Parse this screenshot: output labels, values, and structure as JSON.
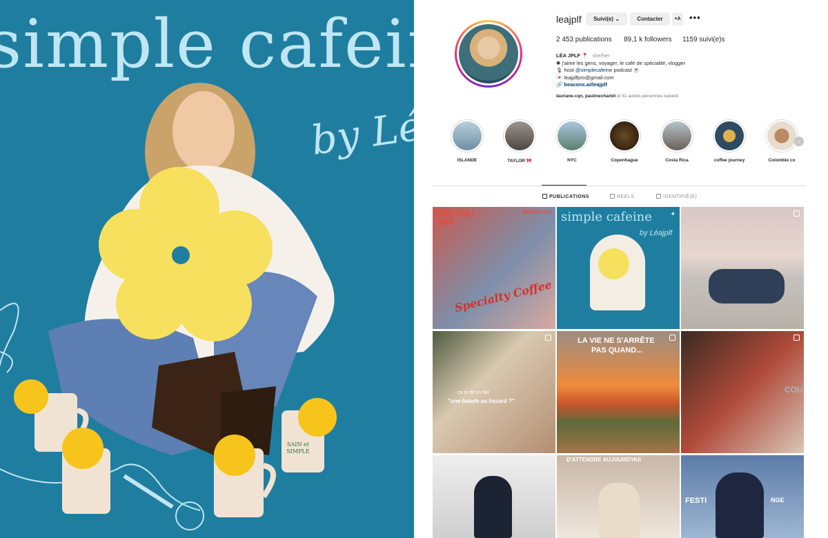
{
  "poster": {
    "title": "simple cafeine",
    "byline": "by Léajplf",
    "mug_text": "SAIN et SIMPLE",
    "colors": {
      "background": "#1f7ea0",
      "lettering": "#bfe6f2",
      "flower": "#f6e05e"
    }
  },
  "profile": {
    "username": "leajplf",
    "follow_label": "Suivi(e) ⌄",
    "contact_label": "Contacter",
    "suggest_label": "+A",
    "more_label": "•••",
    "stats": {
      "posts": "2 453 publications",
      "followers": "89,1 k followers",
      "following": "1159 suivi(e)s"
    },
    "bio": {
      "name": "LÉA JPLF 📍",
      "pronouns": "she/her",
      "line1": "✺ j'aime les gens, voyager, le café de spécialité, vlogger",
      "line2_prefix": "🎙 host",
      "line2_mention": "@simplecafeine",
      "line2_suffix": "podcast ☕",
      "line3": "💌 leajplfpro@gmail.com",
      "link": "🔗 beacons.ai/leajplf"
    },
    "followed_by_names": "lauriane.cqn, paulinecharbit",
    "followed_by_rest": "et 51 autres personnes suivent",
    "highlights": [
      {
        "label": "ISLANDE",
        "color": "#8fa9b8"
      },
      {
        "label": "TAYLOR 🎀",
        "color": "#7d7672"
      },
      {
        "label": "NYC",
        "color": "#7da3c9"
      },
      {
        "label": "Copenhague",
        "color": "#3a2a18"
      },
      {
        "label": "Costa Rica",
        "color": "#8a9aa6"
      },
      {
        "label": "coffee journey",
        "color": "#2d4c63"
      },
      {
        "label": "Colombie co",
        "color": "#d8c9b8"
      }
    ],
    "tabs": {
      "posts": "PUBLICATIONS",
      "reels": "REELS",
      "tagged": "IDENTIFIÉ(E)"
    },
    "posts": [
      {
        "id": "p1",
        "text_a": "DID YOU SAY",
        "text_b": "Specialty Coffee",
        "text_c": "ÉDITION N°3"
      },
      {
        "id": "p2",
        "text_a": "simple cafeine",
        "text_b": "by Léajplf"
      },
      {
        "id": "p3"
      },
      {
        "id": "p4",
        "text_a": "ça te dit on fait",
        "text_b": "\"une balade au hasard ?\""
      },
      {
        "id": "p5",
        "text_a": "LA VIE NE S'ARRÊTE",
        "text_b": "PAS QUAND..."
      },
      {
        "id": "p6",
        "text_a": "COU"
      },
      {
        "id": "p7"
      },
      {
        "id": "p8",
        "text_a": "D'ATTENDRE AUJOURD'HUI"
      },
      {
        "id": "p9",
        "text_a": "FESTI",
        "text_b": "NGE"
      }
    ]
  }
}
